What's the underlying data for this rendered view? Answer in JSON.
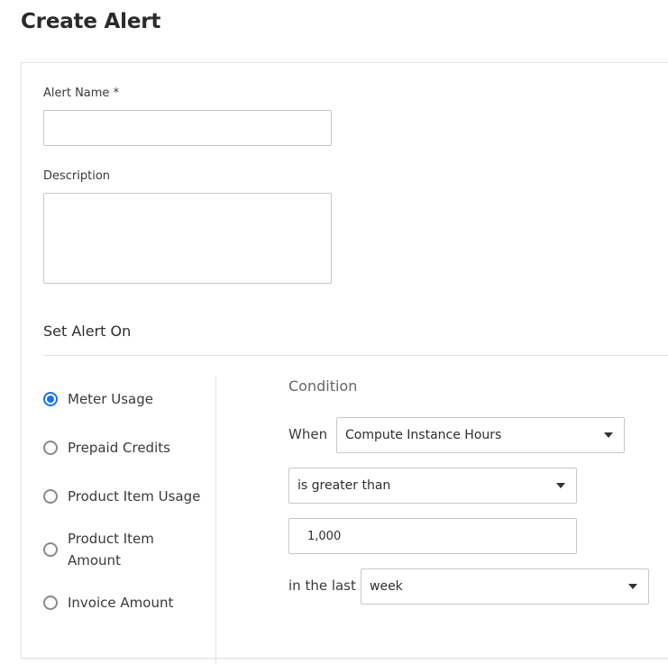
{
  "page": {
    "title": "Create Alert"
  },
  "form": {
    "alert_name_label": "Alert Name",
    "required_marker": "*",
    "alert_name_value": "",
    "description_label": "Description",
    "description_value": ""
  },
  "alert_on": {
    "title": "Set Alert On",
    "options": [
      {
        "label": "Meter Usage",
        "checked": true
      },
      {
        "label": "Prepaid Credits",
        "checked": false
      },
      {
        "label": "Product Item Usage",
        "checked": false
      },
      {
        "label": "Product Item Amount",
        "checked": false
      },
      {
        "label": "Invoice Amount",
        "checked": false
      }
    ]
  },
  "condition": {
    "title": "Condition",
    "when_label": "When",
    "metric_value": "Compute Instance Hours",
    "operator_value": "is greater than",
    "threshold_value": "1,000",
    "period_label": "in the last",
    "period_value": "week"
  },
  "colors": {
    "accent": "#1a73e8"
  }
}
